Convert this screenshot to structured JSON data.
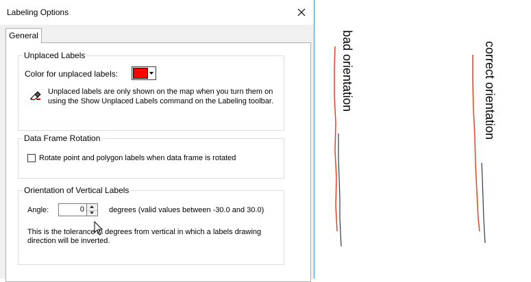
{
  "dialog": {
    "title": "Labeling Options",
    "tab_general": "General"
  },
  "unplaced": {
    "group_title": "Unplaced Labels",
    "color_label": "Color for unplaced labels:",
    "color_value": "#ff0000",
    "info_line1": "Unplaced labels are only shown on the map when you turn them on",
    "info_line2": "using the Show Unplaced Labels command on the Labeling toolbar."
  },
  "rotation": {
    "group_title": "Data Frame Rotation",
    "checkbox_label": "Rotate point and polygon labels when data frame is rotated",
    "checked": false
  },
  "orientation": {
    "group_title": "Orientation of Vertical Labels",
    "angle_label": "Angle:",
    "angle_value": "0",
    "degrees_text": "degrees (valid values between -30.0 and 30.0)",
    "desc_line1": "This is the tolerance in degrees from vertical in which a labels drawing",
    "desc_line2": "direction will be inverted."
  },
  "map": {
    "label_bad": "bad orientation",
    "label_good": "correct orientation",
    "line_red": "#e8401c",
    "line_dark": "#2b3a4a"
  }
}
